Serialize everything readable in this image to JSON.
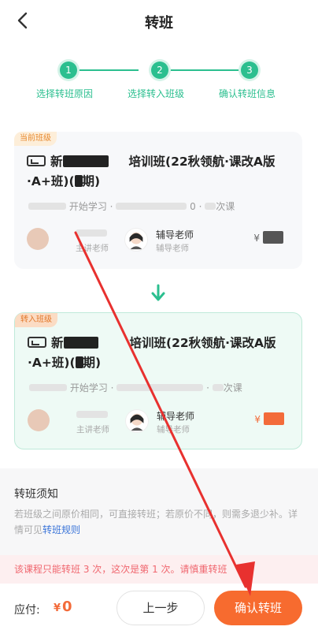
{
  "header": {
    "title": "转班"
  },
  "steps": [
    {
      "num": "1",
      "label": "选择转班原因"
    },
    {
      "num": "2",
      "label": "选择转入班级"
    },
    {
      "num": "3",
      "label": "确认转班信息"
    }
  ],
  "current_class": {
    "tag": "当前班级",
    "name_prefix": "新",
    "name_suffix": "培训班(22秋领航·课改A版·A+班)(",
    "name_end": "期)",
    "meta_start": "开始学习",
    "meta_count": "0",
    "meta_unit": "次课",
    "teacher1_role": "主讲老师",
    "teacher2_name": "辅导老师",
    "teacher2_role": "辅导老师",
    "price_symbol": "¥"
  },
  "target_class": {
    "tag": "转入班级",
    "name_prefix": "新",
    "name_suffix": "培训班(22秋领航·课改A版·A+班)(",
    "name_end": "期)",
    "meta_start": "开始学习",
    "meta_unit": "次课",
    "teacher1_role": "主讲老师",
    "teacher2_name": "辅导老师",
    "teacher2_role": "辅导老师",
    "price_symbol": "¥"
  },
  "notice": {
    "title": "转班须知",
    "text": "若班级之间原价相同，可直接转班；若原价不同，则需多退少补。详情可见",
    "link": "转班规则"
  },
  "warning": "该课程只能转班 3 次，这次是第 1 次。请慎重转班",
  "footer": {
    "pay_label": "应付:",
    "currency": "¥",
    "amount": "0",
    "prev_label": "上一步",
    "confirm_label": "确认转班"
  },
  "colors": {
    "accent": "#2bbf8f",
    "orange": "#f76b2f",
    "warning_text": "#f0676f",
    "annotation": "#e8312f"
  },
  "icons": [
    "back-arrow-icon",
    "class-icon",
    "down-arrow-icon"
  ]
}
